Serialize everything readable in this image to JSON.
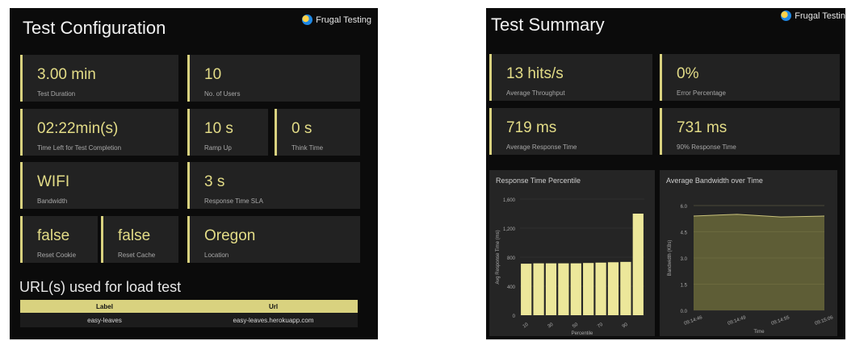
{
  "config": {
    "title": "Test Configuration",
    "brand": "Frugal Testing",
    "cards": {
      "duration": {
        "value": "3.00 min",
        "label": "Test Duration"
      },
      "users": {
        "value": "10",
        "label": "No. of Users"
      },
      "time_left": {
        "value": "02:22min(s)",
        "label": "Time Left for Test Completion"
      },
      "ramp_up": {
        "value": "10 s",
        "label": "Ramp Up"
      },
      "think_time": {
        "value": "0 s",
        "label": "Think Time"
      },
      "bandwidth": {
        "value": "WIFI",
        "label": "Bandwidth"
      },
      "sla": {
        "value": "3 s",
        "label": "Response Time SLA"
      },
      "reset_cookie": {
        "value": "false",
        "label": "Reset Cookie"
      },
      "reset_cache": {
        "value": "false",
        "label": "Reset Cache"
      },
      "location": {
        "value": "Oregon",
        "label": "Location"
      }
    },
    "urls_heading": "URL(s) used for load test",
    "url_table": {
      "headers": [
        "Label",
        "Url"
      ],
      "rows": [
        [
          "easy-leaves",
          "easy-leaves.herokuapp.com"
        ]
      ]
    }
  },
  "summary": {
    "title": "Test Summary",
    "brand": "Frugal Testin",
    "cards": {
      "throughput": {
        "value": "13 hits/s",
        "label": "Average Throughput"
      },
      "error": {
        "value": "0%",
        "label": "Error Percentage"
      },
      "avg_rt": {
        "value": "719 ms",
        "label": "Average Response Time"
      },
      "p90_rt": {
        "value": "731 ms",
        "label": "90% Response Time"
      }
    }
  },
  "accent_color": "#d9d27f",
  "chart_data": [
    {
      "type": "bar",
      "title": "Response Time Percentile",
      "xlabel": "Percentile",
      "ylabel": "Avg Response Time (ms)",
      "ylim": [
        0,
        1600
      ],
      "yticks": [
        0,
        400,
        800,
        1200,
        1600
      ],
      "yticklabels": [
        "0",
        "400",
        "800",
        "1,200",
        "1,600"
      ],
      "xticks": [
        "10",
        "30",
        "50",
        "70",
        "90"
      ],
      "categories": [
        "10",
        "20",
        "30",
        "40",
        "50",
        "60",
        "70",
        "80",
        "90",
        "100"
      ],
      "values": [
        710,
        715,
        715,
        715,
        715,
        720,
        725,
        730,
        735,
        1400
      ],
      "bar_color": "#ece79a"
    },
    {
      "type": "area",
      "title": "Average Bandwidth over Time",
      "xlabel": "Time",
      "ylabel": "Bandwidth (KBs)",
      "ylim": [
        0,
        6.0
      ],
      "yticks": [
        0,
        1.5,
        3.0,
        4.5,
        6.0
      ],
      "yticklabels": [
        "0.0",
        "1.5",
        "3.0",
        "4.5",
        "6.0"
      ],
      "x": [
        "09:14:49",
        "09:14:52",
        "09:14:55",
        "09:14:58"
      ],
      "xticklabels": [
        "09:14:46",
        "09:14:49",
        "09:14:55",
        "09:15:06"
      ],
      "values": [
        5.4,
        5.5,
        5.35,
        5.4
      ],
      "fill_color": "#5e5d36",
      "line_color": "#c9c27a"
    }
  ]
}
